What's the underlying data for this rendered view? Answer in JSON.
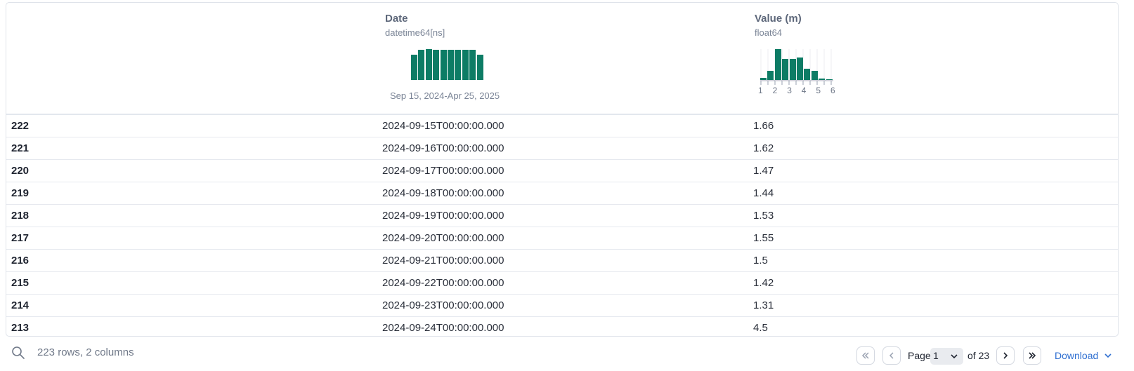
{
  "columns": {
    "date": {
      "name": "Date",
      "dtype": "datetime64[ns]",
      "range": "Sep 15, 2024-Apr 25, 2025",
      "histogram": [
        0.82,
        0.97,
        1.0,
        0.97,
        0.97,
        0.97,
        0.97,
        0.97,
        0.97,
        0.82
      ]
    },
    "value": {
      "name": "Value (m)",
      "dtype": "float64",
      "ticks": [
        "1",
        "2",
        "3",
        "4",
        "5",
        "6"
      ],
      "histogram": [
        0.07,
        0.3,
        1.0,
        0.68,
        0.68,
        0.72,
        0.36,
        0.29,
        0.05,
        0.02
      ]
    }
  },
  "rows": [
    {
      "index": "222",
      "date": "2024-09-15T00:00:00.000",
      "value": "1.66"
    },
    {
      "index": "221",
      "date": "2024-09-16T00:00:00.000",
      "value": "1.62"
    },
    {
      "index": "220",
      "date": "2024-09-17T00:00:00.000",
      "value": "1.47"
    },
    {
      "index": "219",
      "date": "2024-09-18T00:00:00.000",
      "value": "1.44"
    },
    {
      "index": "218",
      "date": "2024-09-19T00:00:00.000",
      "value": "1.53"
    },
    {
      "index": "217",
      "date": "2024-09-20T00:00:00.000",
      "value": "1.55"
    },
    {
      "index": "216",
      "date": "2024-09-21T00:00:00.000",
      "value": "1.5"
    },
    {
      "index": "215",
      "date": "2024-09-22T00:00:00.000",
      "value": "1.42"
    },
    {
      "index": "214",
      "date": "2024-09-23T00:00:00.000",
      "value": "1.31"
    },
    {
      "index": "213",
      "date": "2024-09-24T00:00:00.000",
      "value": "4.5"
    }
  ],
  "footer": {
    "summary": "223 rows, 2 columns",
    "page_label": "Page",
    "current_page": "1",
    "of_label": "of 23",
    "download_label": "Download"
  },
  "colors": {
    "histogram_bar": "#0d7c65",
    "link": "#2f6fd1"
  },
  "icons": [
    "search-icon",
    "first-page-icon",
    "prev-page-icon",
    "next-page-icon",
    "last-page-icon",
    "chevron-down-icon"
  ]
}
